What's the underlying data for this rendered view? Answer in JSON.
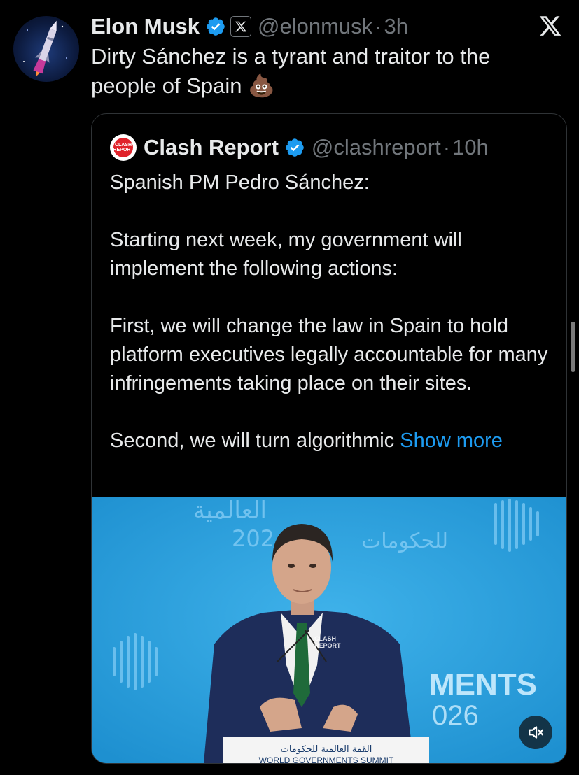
{
  "tweet": {
    "author_name": "Elon Musk",
    "handle": "@elonmusk",
    "separator": "·",
    "time": "3h",
    "text": "Dirty Sánchez is a tyrant and traitor to the people of Spain",
    "emoji": "💩",
    "avatar_icon": "rocket-icon"
  },
  "quote": {
    "author_name": "Clash Report",
    "handle": "@clashreport",
    "separator": "·",
    "time": "10h",
    "logo_text_line1": "CLASH",
    "logo_text_line2": "REPORT",
    "paragraphs": [
      "Spanish PM Pedro Sánchez:",
      "Starting next week, my government will implement the following actions:",
      "First, we will change the law in Spain to hold platform executives legally accountable for many infringements taking place on their sites."
    ],
    "last_paragraph": "Second, we will turn algorithmic",
    "show_more_label": "Show more"
  },
  "video": {
    "backdrop_arabic_top": "العالمية",
    "backdrop_year_partial": "202",
    "backdrop_arabic_2": "للحكومات",
    "backdrop_right_text": "MENTS",
    "backdrop_right_year": "026",
    "lapel_watermark_1": "CLASH",
    "lapel_watermark_2": "REPORT",
    "podium_arabic": "القمة العالمية للحكومات",
    "podium_english": "WORLD GOVERNMENTS SUMMIT",
    "mute_icon": "speaker-muted-icon"
  },
  "colors": {
    "background": "#000000",
    "text": "#e7e9ea",
    "muted": "#71767b",
    "accent": "#1d9bf0",
    "border": "#2f3336",
    "video_bg": "#2b9fd9"
  }
}
